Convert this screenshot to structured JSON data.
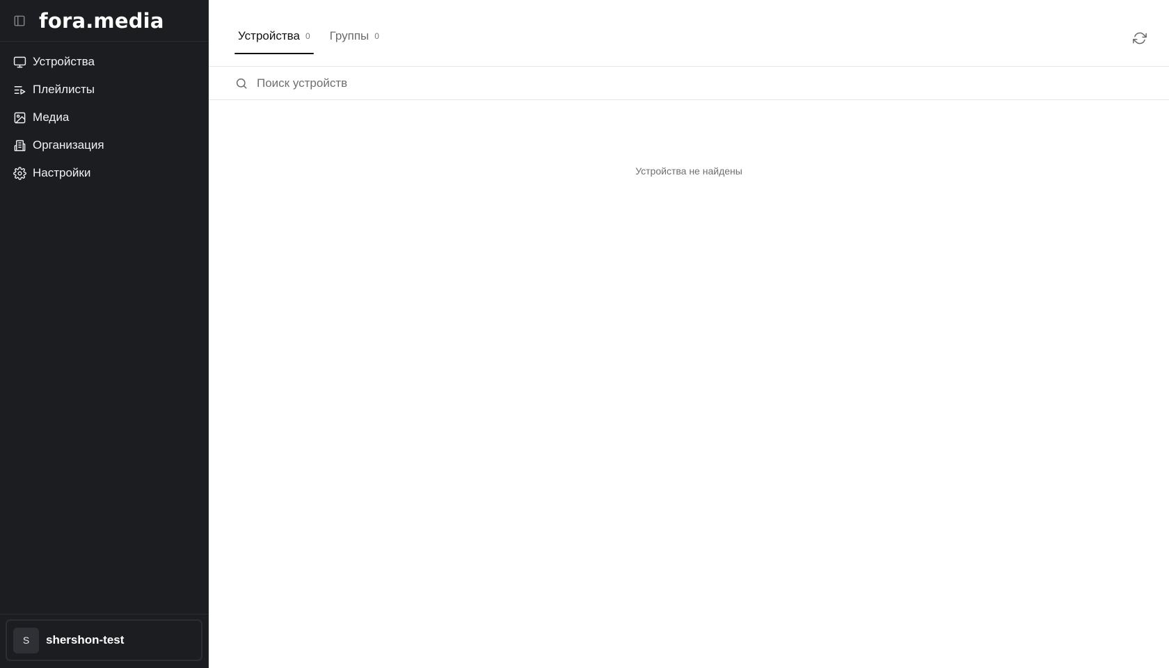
{
  "sidebar": {
    "logo": "fora.media",
    "items": [
      {
        "label": "Устройства",
        "icon": "monitor-icon"
      },
      {
        "label": "Плейлисты",
        "icon": "playlist-icon"
      },
      {
        "label": "Медиа",
        "icon": "image-icon"
      },
      {
        "label": "Организация",
        "icon": "building-icon"
      },
      {
        "label": "Настройки",
        "icon": "gear-icon"
      }
    ],
    "account": {
      "initial": "S",
      "name": "shershon-test"
    }
  },
  "main": {
    "tabs": [
      {
        "label": "Устройства",
        "count": "0",
        "active": true
      },
      {
        "label": "Группы",
        "count": "0",
        "active": false
      }
    ],
    "search": {
      "placeholder": "Поиск устройств",
      "value": ""
    },
    "empty_message": "Устройства не найдены"
  },
  "colors": {
    "sidebar_bg": "#1c1d21",
    "main_bg": "#ffffff",
    "active_tab_underline": "#111111"
  }
}
